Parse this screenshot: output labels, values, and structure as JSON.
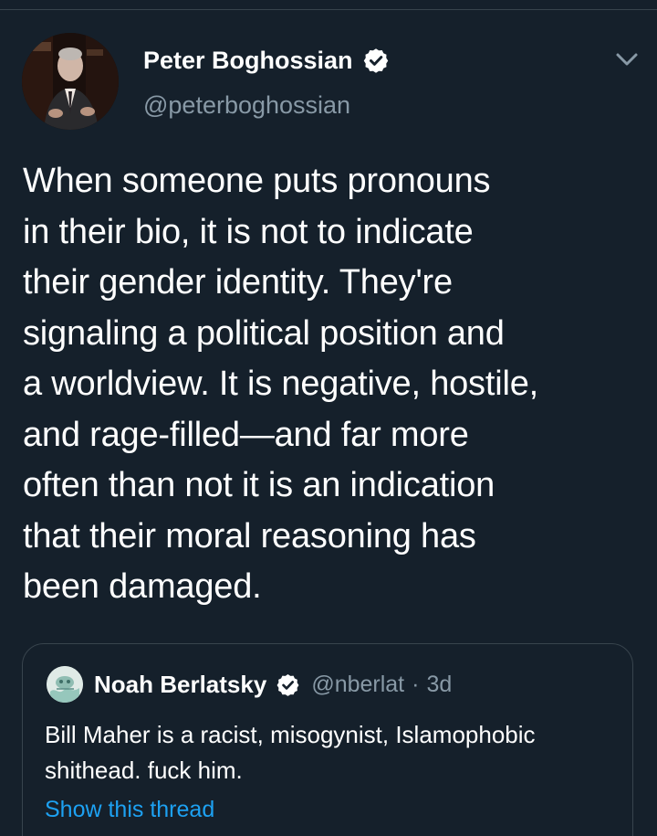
{
  "tweet": {
    "author": {
      "name": "Peter Boghossian",
      "handle": "@peterboghossian",
      "verified": true
    },
    "text": "When someone puts pronouns\nin their bio, it is not to indicate\ntheir gender identity. They're\nsignaling a political position and\na worldview. It is negative, hostile,\nand rage-filled—and far more\noften than not it is an indication\nthat their moral reasoning has\nbeen damaged.",
    "menu_icon": "chevron-down-icon"
  },
  "quoted_tweet": {
    "author": {
      "name": "Noah Berlatsky",
      "handle": "@nberlat",
      "verified": true
    },
    "separator": "·",
    "time": "3d",
    "text": "Bill Maher is a racist, misogynist, Islamophobic\nshithead. fuck him.",
    "show_thread_label": "Show this thread"
  },
  "colors": {
    "background": "#15202b",
    "border": "#38444d",
    "secondary_text": "#8899a6",
    "link": "#1da1f2",
    "primary_text": "#ffffff",
    "verified_badge": "#ffffff"
  }
}
